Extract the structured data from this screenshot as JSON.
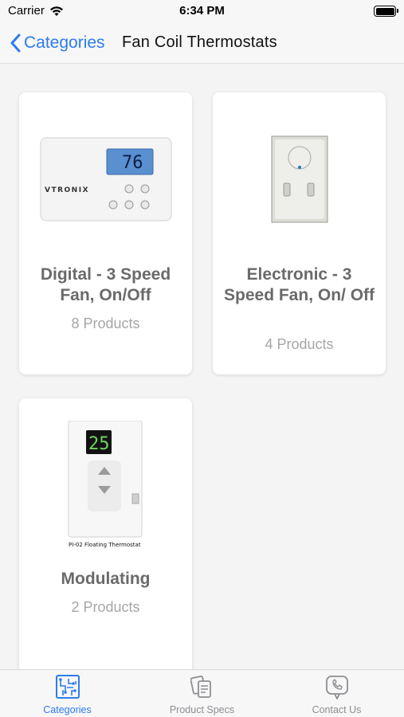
{
  "status_bar": {
    "carrier": "Carrier",
    "time": "6:34 PM"
  },
  "nav": {
    "back_label": "Categories",
    "title": "Fan Coil Thermostats"
  },
  "products": [
    {
      "title": "Digital - 3 Speed Fan, On/Off",
      "count": "8 Products",
      "image": "digital-thermostat-image",
      "display_reading": "76",
      "brand": "VTRONIX"
    },
    {
      "title": "Electronic - 3 Speed Fan, On/ Off",
      "count": "4 Products",
      "image": "electronic-thermostat-image"
    },
    {
      "title": "Modulating",
      "count": "2 Products",
      "image": "modulating-thermostat-image",
      "display_reading": "25",
      "caption": "PI-02 Floating Thermostat"
    }
  ],
  "tabs": [
    {
      "label": "Categories",
      "icon": "circuit-board-icon",
      "active": true
    },
    {
      "label": "Product Specs",
      "icon": "documents-icon",
      "active": false
    },
    {
      "label": "Contact Us",
      "icon": "phone-bubble-icon",
      "active": false
    }
  ],
  "colors": {
    "accent": "#2d7bf0",
    "card_title": "#6a6a6a",
    "card_count": "#a6a6a6",
    "background": "#f4f4f5"
  }
}
